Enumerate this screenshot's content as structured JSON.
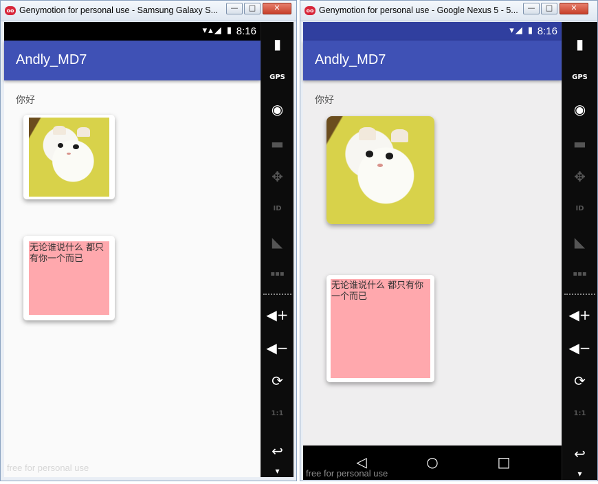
{
  "windows": [
    {
      "title": "Genymotion for personal use - Samsung Galaxy S...",
      "logo": "oo",
      "buttons": {
        "minimize": "—",
        "maximize": "□",
        "close": "✕"
      },
      "status_time": "8:16",
      "status_icons": "▾▴◢ ▮",
      "app_title": "Andly_MD7",
      "hello_text": "你好",
      "card_text": "无论谁说什么 都只有你一个而已",
      "watermark": "free for personal use"
    },
    {
      "title": "Genymotion for personal use - Google Nexus 5 - 5...",
      "logo": "oo",
      "buttons": {
        "minimize": "—",
        "maximize": "□",
        "close": "✕"
      },
      "status_time": "8:16",
      "status_icons": "▾◢ ▮",
      "app_title": "Andly_MD7",
      "hello_text": "你好",
      "card_text": "无论谁说什么 都只有你一个而已",
      "watermark": "free for personal use",
      "nav": {
        "back": "◁",
        "home": "○",
        "recents": "□"
      }
    }
  ],
  "sidebar": {
    "battery": "▮",
    "gps": "GPS",
    "camera": "◉",
    "capture": "▬",
    "dpad": "✥",
    "id": "ID",
    "cast": "◣",
    "sms": "▪▪▪",
    "volume_up": "◀+",
    "volume_down": "◀−",
    "rotate": "⟳",
    "pixel_perfect": "1:1",
    "back": "↩",
    "more": "▾"
  }
}
